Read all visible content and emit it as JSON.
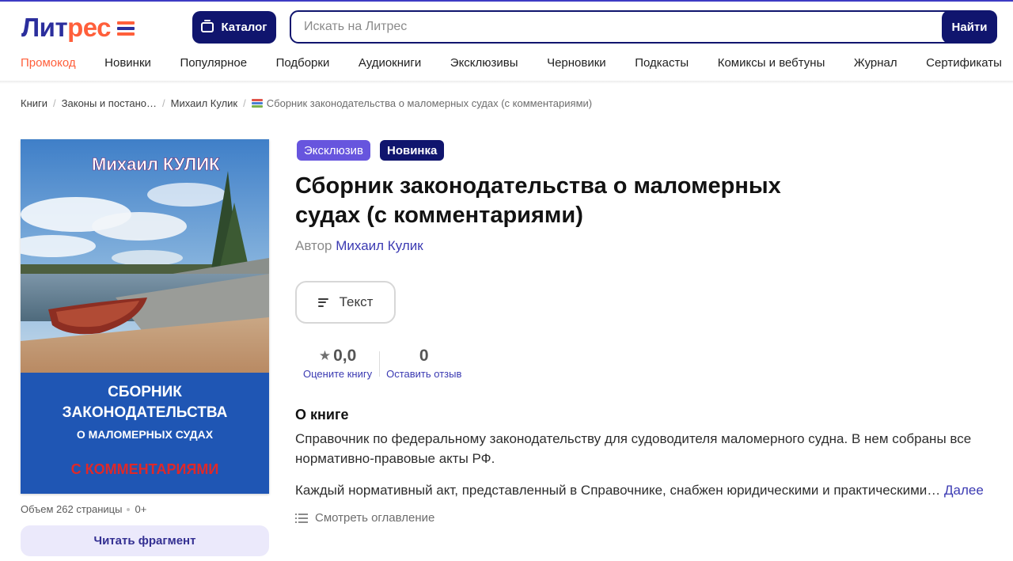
{
  "header": {
    "logo_part1": "Лит",
    "logo_part2": "рес",
    "catalog_label": "Каталог",
    "search_placeholder": "Искать на Литрес",
    "search_button": "Найти"
  },
  "nav": [
    "Промокод",
    "Новинки",
    "Популярное",
    "Подборки",
    "Аудиокниги",
    "Эксклюзивы",
    "Черновики",
    "Подкасты",
    "Комиксы и вебтуны",
    "Журнал",
    "Сертификаты"
  ],
  "breadcrumb": {
    "items": [
      "Книги",
      "Законы и постано…",
      "Михаил Кулик"
    ],
    "current": "Сборник законодательства о маломерных судах (с комментариями)"
  },
  "cover": {
    "author_text": "Михаил КУЛИК",
    "title_line1": "СБОРНИК",
    "title_line2": "ЗАКОНОДАТЕЛЬСТВА",
    "title_line3": "О МАЛОМЕРНЫХ СУДАХ",
    "title_line4": "С КОММЕНТАРИЯМИ"
  },
  "book": {
    "badge_exclusive": "Эксклюзив",
    "badge_new": "Новинка",
    "title": "Сборник законодательства о маломерных судах (с комментариями)",
    "author_label": "Автор",
    "author_name": "Михаил Кулик",
    "format_label": "Текст",
    "volume": "Объем 262 страницы",
    "age": "0+",
    "read_button": "Читать фрагмент"
  },
  "ratings": {
    "score": "0,0",
    "score_link": "Оцените книгу",
    "reviews": "0",
    "reviews_link": "Оставить отзыв"
  },
  "about": {
    "heading": "О книге",
    "paragraph1": "Справочник по федеральному законодательству для судоводителя маломерного судна. В нем собраны все нормативно-правовые акты РФ.",
    "paragraph2": "Каждый нормативный акт, представленный в Справочнике, снабжен юридическими и практическими…",
    "more": "Далее",
    "toc": "Смотреть оглавление"
  },
  "colors": {
    "brand_dark": "#10156e",
    "brand_orange": "#ff5f3b",
    "badge_exclusive": "#6755de",
    "link": "#3b3ab2"
  }
}
